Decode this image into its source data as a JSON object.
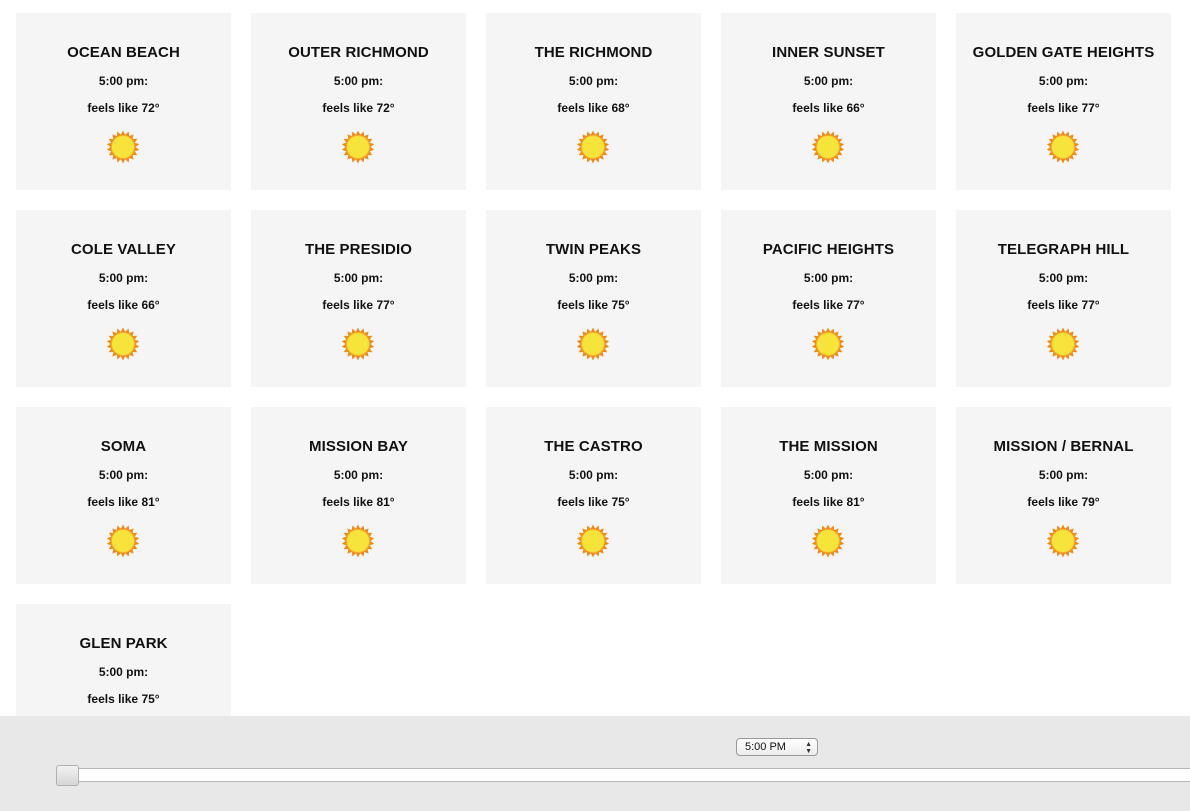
{
  "neighborhoods": [
    {
      "name": "OCEAN BEACH",
      "time": "5:00 pm:",
      "feels": "feels like 72°",
      "icon": "sun-icon"
    },
    {
      "name": "OUTER RICHMOND",
      "time": "5:00 pm:",
      "feels": "feels like 72°",
      "icon": "sun-icon"
    },
    {
      "name": "THE RICHMOND",
      "time": "5:00 pm:",
      "feels": "feels like 68°",
      "icon": "sun-icon"
    },
    {
      "name": "INNER SUNSET",
      "time": "5:00 pm:",
      "feels": "feels like 66°",
      "icon": "sun-icon"
    },
    {
      "name": "GOLDEN GATE HEIGHTS",
      "time": "5:00 pm:",
      "feels": "feels like 77°",
      "icon": "sun-icon"
    },
    {
      "name": "COLE VALLEY",
      "time": "5:00 pm:",
      "feels": "feels like 66°",
      "icon": "sun-icon"
    },
    {
      "name": "THE PRESIDIO",
      "time": "5:00 pm:",
      "feels": "feels like 77°",
      "icon": "sun-icon"
    },
    {
      "name": "TWIN PEAKS",
      "time": "5:00 pm:",
      "feels": "feels like 75°",
      "icon": "sun-icon"
    },
    {
      "name": "PACIFIC HEIGHTS",
      "time": "5:00 pm:",
      "feels": "feels like 77°",
      "icon": "sun-icon"
    },
    {
      "name": "TELEGRAPH HILL",
      "time": "5:00 pm:",
      "feels": "feels like 77°",
      "icon": "sun-icon"
    },
    {
      "name": "SOMA",
      "time": "5:00 pm:",
      "feels": "feels like 81°",
      "icon": "sun-icon"
    },
    {
      "name": "MISSION BAY",
      "time": "5:00 pm:",
      "feels": "feels like 81°",
      "icon": "sun-icon"
    },
    {
      "name": "THE CASTRO",
      "time": "5:00 pm:",
      "feels": "feels like 75°",
      "icon": "sun-icon"
    },
    {
      "name": "THE MISSION",
      "time": "5:00 pm:",
      "feels": "feels like 81°",
      "icon": "sun-icon"
    },
    {
      "name": "MISSION / BERNAL",
      "time": "5:00 pm:",
      "feels": "feels like 79°",
      "icon": "sun-icon"
    },
    {
      "name": "GLEN PARK",
      "time": "5:00 pm:",
      "feels": "feels like 75°",
      "icon": "sun-icon"
    }
  ],
  "controls": {
    "time_select": {
      "value": "5:00 PM",
      "arrows": "▲▼"
    },
    "time_slider": {
      "position": 0
    }
  },
  "colors": {
    "card_bg": "#f5f5f5",
    "sun_fill": "#f7e43a",
    "sun_rays": "#f08a1c",
    "bar_bg": "#e8e8e8"
  }
}
